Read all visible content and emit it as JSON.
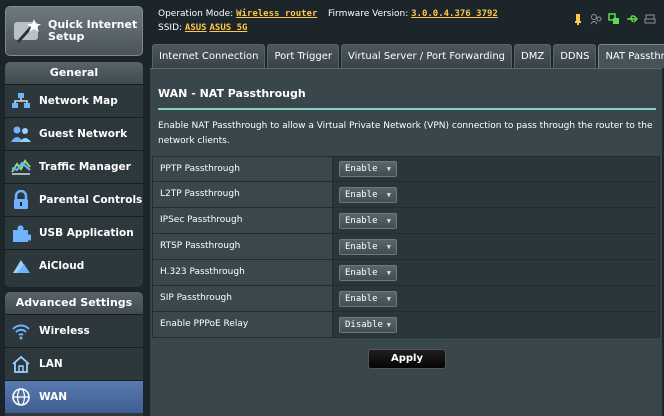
{
  "sidebar": {
    "quick_setup": "Quick Internet Setup",
    "general_head": "General",
    "general_items": [
      {
        "label": "Network Map"
      },
      {
        "label": "Guest Network"
      },
      {
        "label": "Traffic Manager"
      },
      {
        "label": "Parental Controls"
      },
      {
        "label": "USB Application"
      },
      {
        "label": "AiCloud"
      }
    ],
    "advanced_head": "Advanced Settings",
    "advanced_items": [
      {
        "label": "Wireless"
      },
      {
        "label": "LAN"
      },
      {
        "label": "WAN"
      }
    ]
  },
  "status": {
    "mode_label": "Operation Mode:",
    "mode_value": "Wireless router",
    "firmware_label": "Firmware Version:",
    "firmware_value": "3.0.0.4.376_3792",
    "ssid_label": "SSID:",
    "ssid_1": "ASUS",
    "ssid_2": "ASUS_5G"
  },
  "tabs": [
    "Internet Connection",
    "Port Trigger",
    "Virtual Server / Port Forwarding",
    "DMZ",
    "DDNS",
    "NAT Passthrough"
  ],
  "page": {
    "title": "WAN - NAT Passthrough",
    "description": "Enable NAT Passthrough to allow a Virtual Private Network (VPN) connection to pass through the router to the network clients.",
    "apply_label": "Apply"
  },
  "settings": [
    {
      "label": "PPTP Passthrough",
      "value": "Enable"
    },
    {
      "label": "L2TP Passthrough",
      "value": "Enable"
    },
    {
      "label": "IPSec Passthrough",
      "value": "Enable"
    },
    {
      "label": "RTSP Passthrough",
      "value": "Enable"
    },
    {
      "label": "H.323 Passthrough",
      "value": "Enable"
    },
    {
      "label": "SIP Passthrough",
      "value": "Enable"
    },
    {
      "label": "Enable PPPoE Relay",
      "value": "Disable"
    }
  ],
  "colors": {
    "accent_yellow": "#ffc64b",
    "divider_teal": "#8ad0c9",
    "active_blue": "#4a6da3"
  }
}
